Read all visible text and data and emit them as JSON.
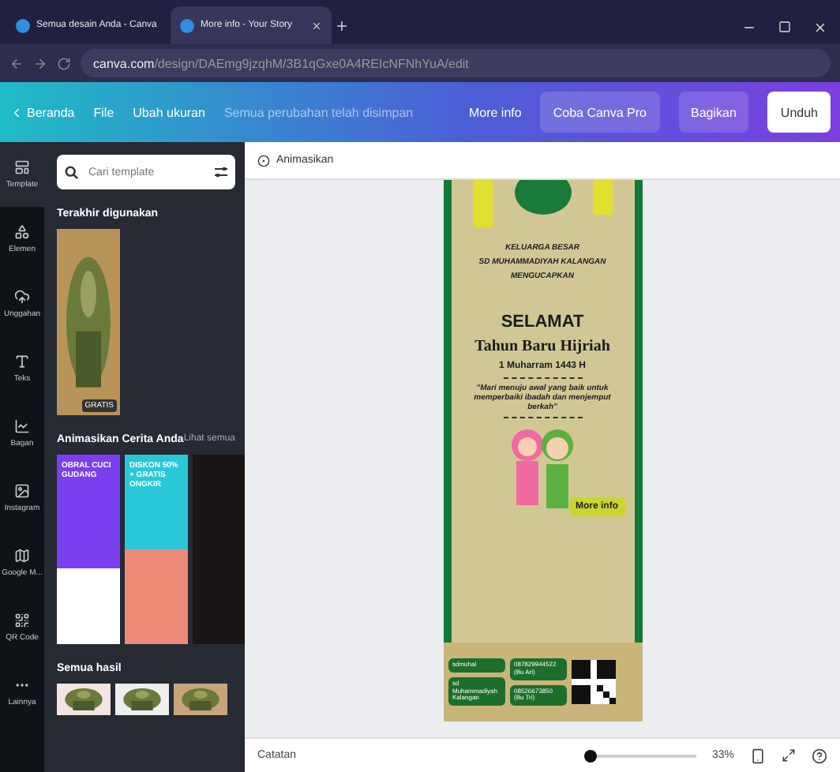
{
  "browser": {
    "tabs": [
      {
        "title": "Semua desain Anda - Canva",
        "selected": false
      },
      {
        "title": "More info - Your Story",
        "selected": true
      }
    ],
    "url_host": "canva.com",
    "url_path": "/design/DAEmg9jzqhM/3B1qGxe0A4REIcNFNhYuA/edit"
  },
  "topbar": {
    "back": "Beranda",
    "menu": [
      "File",
      "Ubah ukuran"
    ],
    "status": "Semua perubahan telah disimpan",
    "more_info": "More info",
    "pro": "Coba Canva Pro",
    "share": "Bagikan",
    "download": "Unduh"
  },
  "rail": [
    {
      "label": "Template",
      "selected": true
    },
    {
      "label": "Elemen",
      "selected": false
    },
    {
      "label": "Unggahan",
      "selected": false
    },
    {
      "label": "Teks",
      "selected": false
    },
    {
      "label": "Bagan",
      "selected": false
    },
    {
      "label": "Instagram",
      "selected": false
    },
    {
      "label": "Google M...",
      "selected": false
    },
    {
      "label": "QR Code",
      "selected": false
    },
    {
      "label": "Lainnya",
      "selected": false
    }
  ],
  "panel": {
    "search": {
      "placeholder": "Cari template"
    },
    "recent_title": "Terakhir digunakan",
    "recent_badge": "GRATIS",
    "animate_title": "Animasikan Cerita Anda",
    "see_all": "Lihat semua",
    "templates": [
      {
        "kind": "bag",
        "text": "OBRAL CUCI GUDANG"
      },
      {
        "kind": "shoe",
        "text": "DISKON 50% + GRATIS ONGKIR"
      },
      {
        "kind": "dark"
      }
    ],
    "results_title": "Semua hasil"
  },
  "toolbar": {
    "animate": "Animasikan"
  },
  "poster": {
    "heading": [
      "KELUARGA BESAR",
      "SD MUHAMMADIYAH KALANGAN",
      "MENGUCAPKAN"
    ],
    "title": "SELAMAT",
    "subtitle": "Tahun Baru Hijriah",
    "date": "1 Muharram 1443 H",
    "quote": "\"Mari menuju awal yang baik untuk memperbaiki ibadah dan menjemput berkah\"",
    "more_info": "More info",
    "socials": [
      "sdmuhal",
      "sd Muhammadiyah Kalangan"
    ],
    "phones": [
      "087829944522 (Bu Ari)",
      "08526673850 (Bu Tri)"
    ]
  },
  "bottom": {
    "notes": "Catatan",
    "zoom": "33%",
    "level": 0.04
  }
}
